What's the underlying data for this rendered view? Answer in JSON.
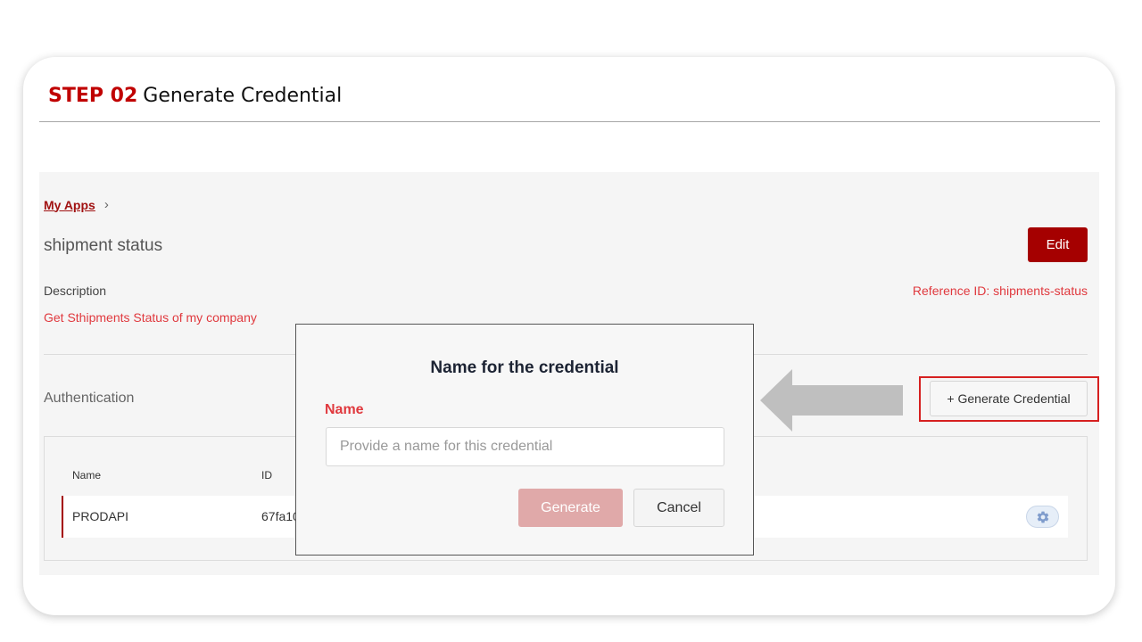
{
  "header": {
    "step_number": "STEP 02",
    "step_title": "Generate Credential"
  },
  "breadcrumb": {
    "link": "My Apps",
    "separator": "›"
  },
  "app": {
    "name": "shipment status",
    "edit_label": "Edit",
    "description_label": "Description",
    "description": "Get Sthipments Status of my company",
    "reference_id": "Reference ID: shipments-status"
  },
  "authentication": {
    "title": "Authentication",
    "generate_label": "+ Generate Credential",
    "columns": [
      "Name",
      "ID"
    ],
    "rows": [
      {
        "name": "PRODAPI",
        "id": "67fa10"
      }
    ]
  },
  "modal": {
    "title": "Name for the credential",
    "name_label": "Name",
    "name_placeholder": "Provide a name for this credential",
    "name_value": "",
    "generate_label": "Generate",
    "cancel_label": "Cancel"
  },
  "colors": {
    "accent": "#c00000",
    "primary_button": "#a50000",
    "link": "#a11212",
    "highlight_text": "#e0393e",
    "disabled_button": "#e0a9a9",
    "annotation_arrow": "#bfbfbf"
  },
  "icons": {
    "breadcrumb_separator": "chevron-right-icon",
    "settings": "gear-icon",
    "annotation": "arrow-left-icon"
  }
}
